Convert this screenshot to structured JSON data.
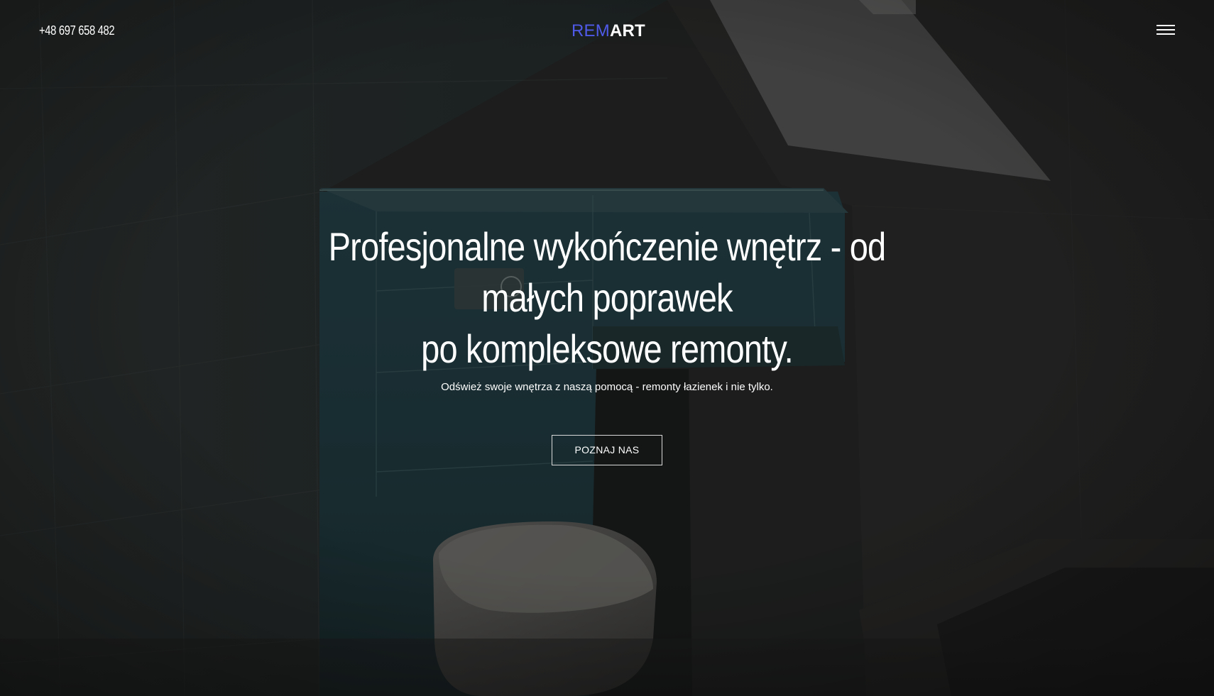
{
  "header": {
    "phone": "+48 697 658 482",
    "logo_part1": "REM",
    "logo_part2": "ART",
    "menu_icon": "hamburger-menu-icon"
  },
  "hero": {
    "title_line1": "Profesjonalne wykończenie wnętrz - od małych poprawek",
    "title_line2": "po kompleksowe remonty.",
    "subtitle": "Odśwież swoje wnętrza z naszą pomocą - remonty łazienek i nie tylko.",
    "cta_label": "POZNAJ NAS",
    "background_image": "bathroom-interior-photo"
  },
  "colors": {
    "logo_accent": "#4f5ae8",
    "text": "#ffffff"
  }
}
